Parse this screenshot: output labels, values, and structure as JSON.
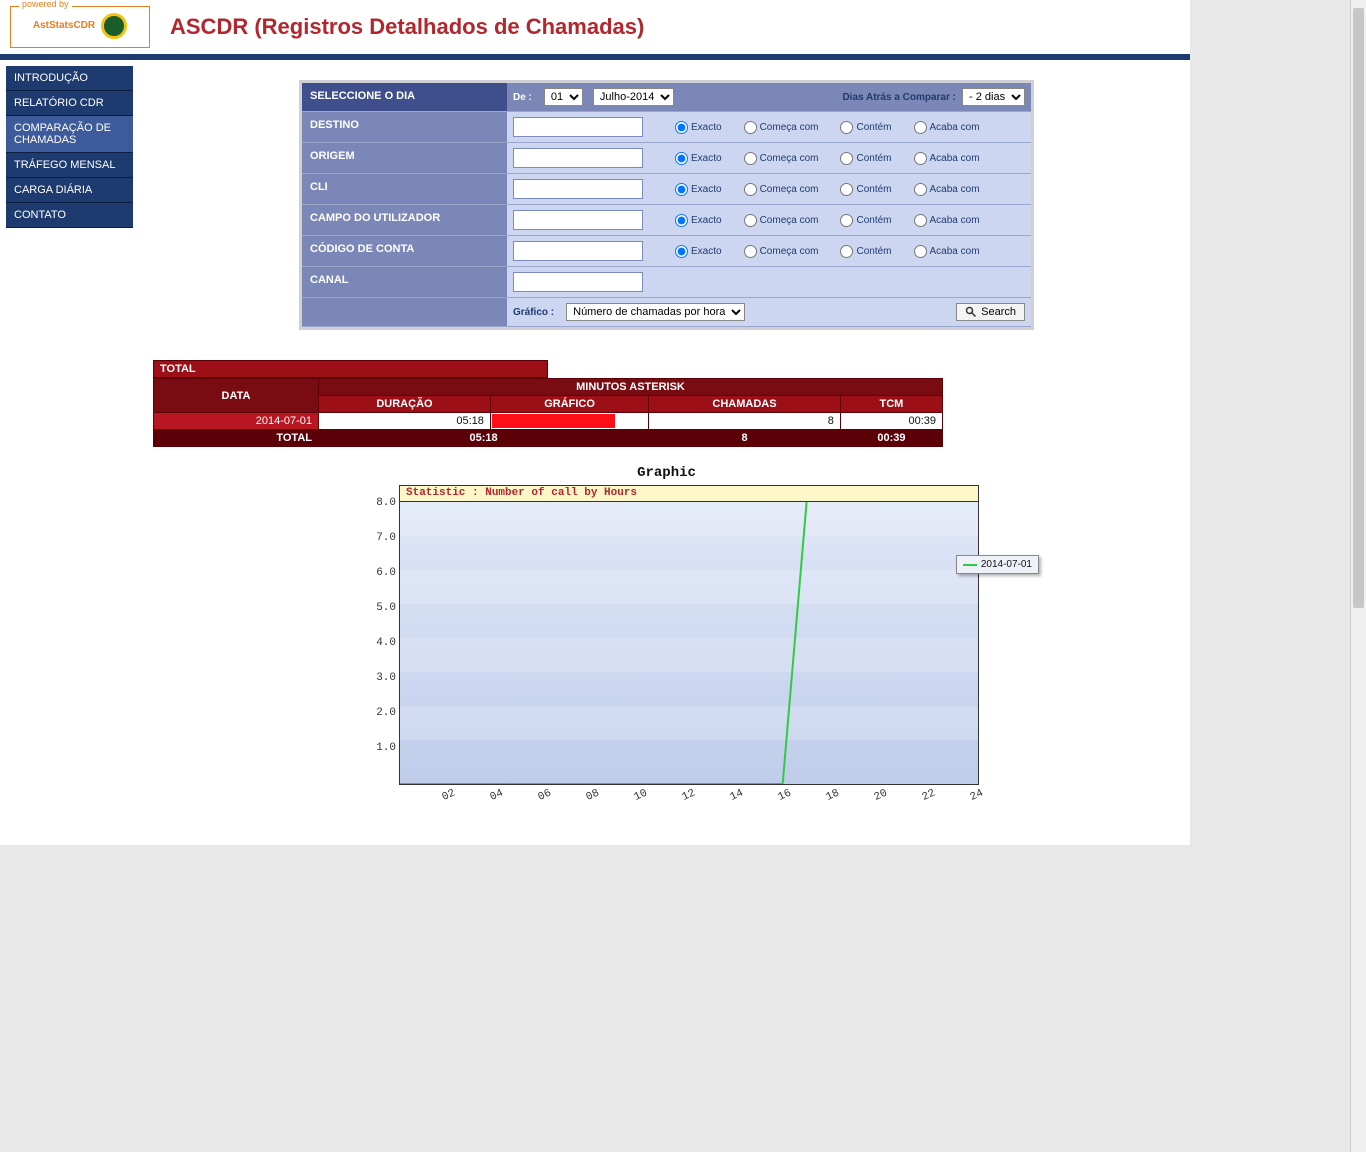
{
  "header": {
    "powered_by": "powered by",
    "brand": "AstStatsCDR",
    "brand_sub": "",
    "title": "ASCDR (Registros Detalhados de Chamadas)"
  },
  "sidebar": {
    "items": [
      "INTRODUÇÃO",
      "RELATÓRIO CDR",
      "COMPARAÇÃO DE CHAMADAS",
      "TRÁFEGO MENSAL",
      "CARGA DIÁRIA",
      "CONTATO"
    ],
    "active_index": 2
  },
  "form": {
    "select_day": "Seleccione o dia",
    "de": "De :",
    "day_value": "01",
    "month_value": "Julho-2014",
    "compare_label": "Dias Atrás a Comparar :",
    "compare_value": "- 2 dias",
    "rows": [
      {
        "label": "DESTINO"
      },
      {
        "label": "ORIGEM"
      },
      {
        "label": "CLI"
      },
      {
        "label": "CAMPO DO UTILIZADOR"
      },
      {
        "label": "CÓDIGO DE CONTA"
      },
      {
        "label": "CANAL",
        "no_radios": true
      }
    ],
    "radios": [
      "Exacto",
      "Começa com",
      "Contém",
      "Acaba com"
    ],
    "grafico_label": "Gráfico :",
    "grafico_value": "Número de chamadas por hora",
    "search": "Search"
  },
  "results": {
    "total_label": "TOTAL",
    "header_span": "MINUTOS ASTERISK",
    "columns": [
      "DATA",
      "DURAÇÃO",
      "GRÁFICO",
      "CHAMADAS",
      "TCM"
    ],
    "row": {
      "date": "2014-07-01",
      "duration": "05:18",
      "calls": "8",
      "tcm": "00:39"
    },
    "footer": {
      "label": "TOTAL",
      "duration": "05:18",
      "calls": "8",
      "tcm": "00:39"
    }
  },
  "chart_data": {
    "type": "line",
    "title": "Graphic",
    "stat_label": "Statistic : Number of call by Hours",
    "x_ticks": [
      "02",
      "04",
      "06",
      "08",
      "10",
      "12",
      "14",
      "16",
      "18",
      "20",
      "22",
      "24"
    ],
    "y_ticks": [
      "1.0",
      "2.0",
      "3.0",
      "4.0",
      "5.0",
      "6.0",
      "7.0",
      "8.0"
    ],
    "xlim": [
      0,
      24
    ],
    "ylim": [
      0,
      8
    ],
    "series": [
      {
        "name": "2014-07-01",
        "x": [
          0,
          1,
          2,
          3,
          4,
          5,
          6,
          7,
          8,
          9,
          10,
          11,
          12,
          13,
          14,
          15,
          16,
          17
        ],
        "values": [
          0,
          0,
          0,
          0,
          0,
          0,
          0,
          0,
          0,
          0,
          0,
          0,
          0,
          0,
          0,
          0,
          0,
          8
        ]
      }
    ],
    "legend": "2014-07-01"
  }
}
